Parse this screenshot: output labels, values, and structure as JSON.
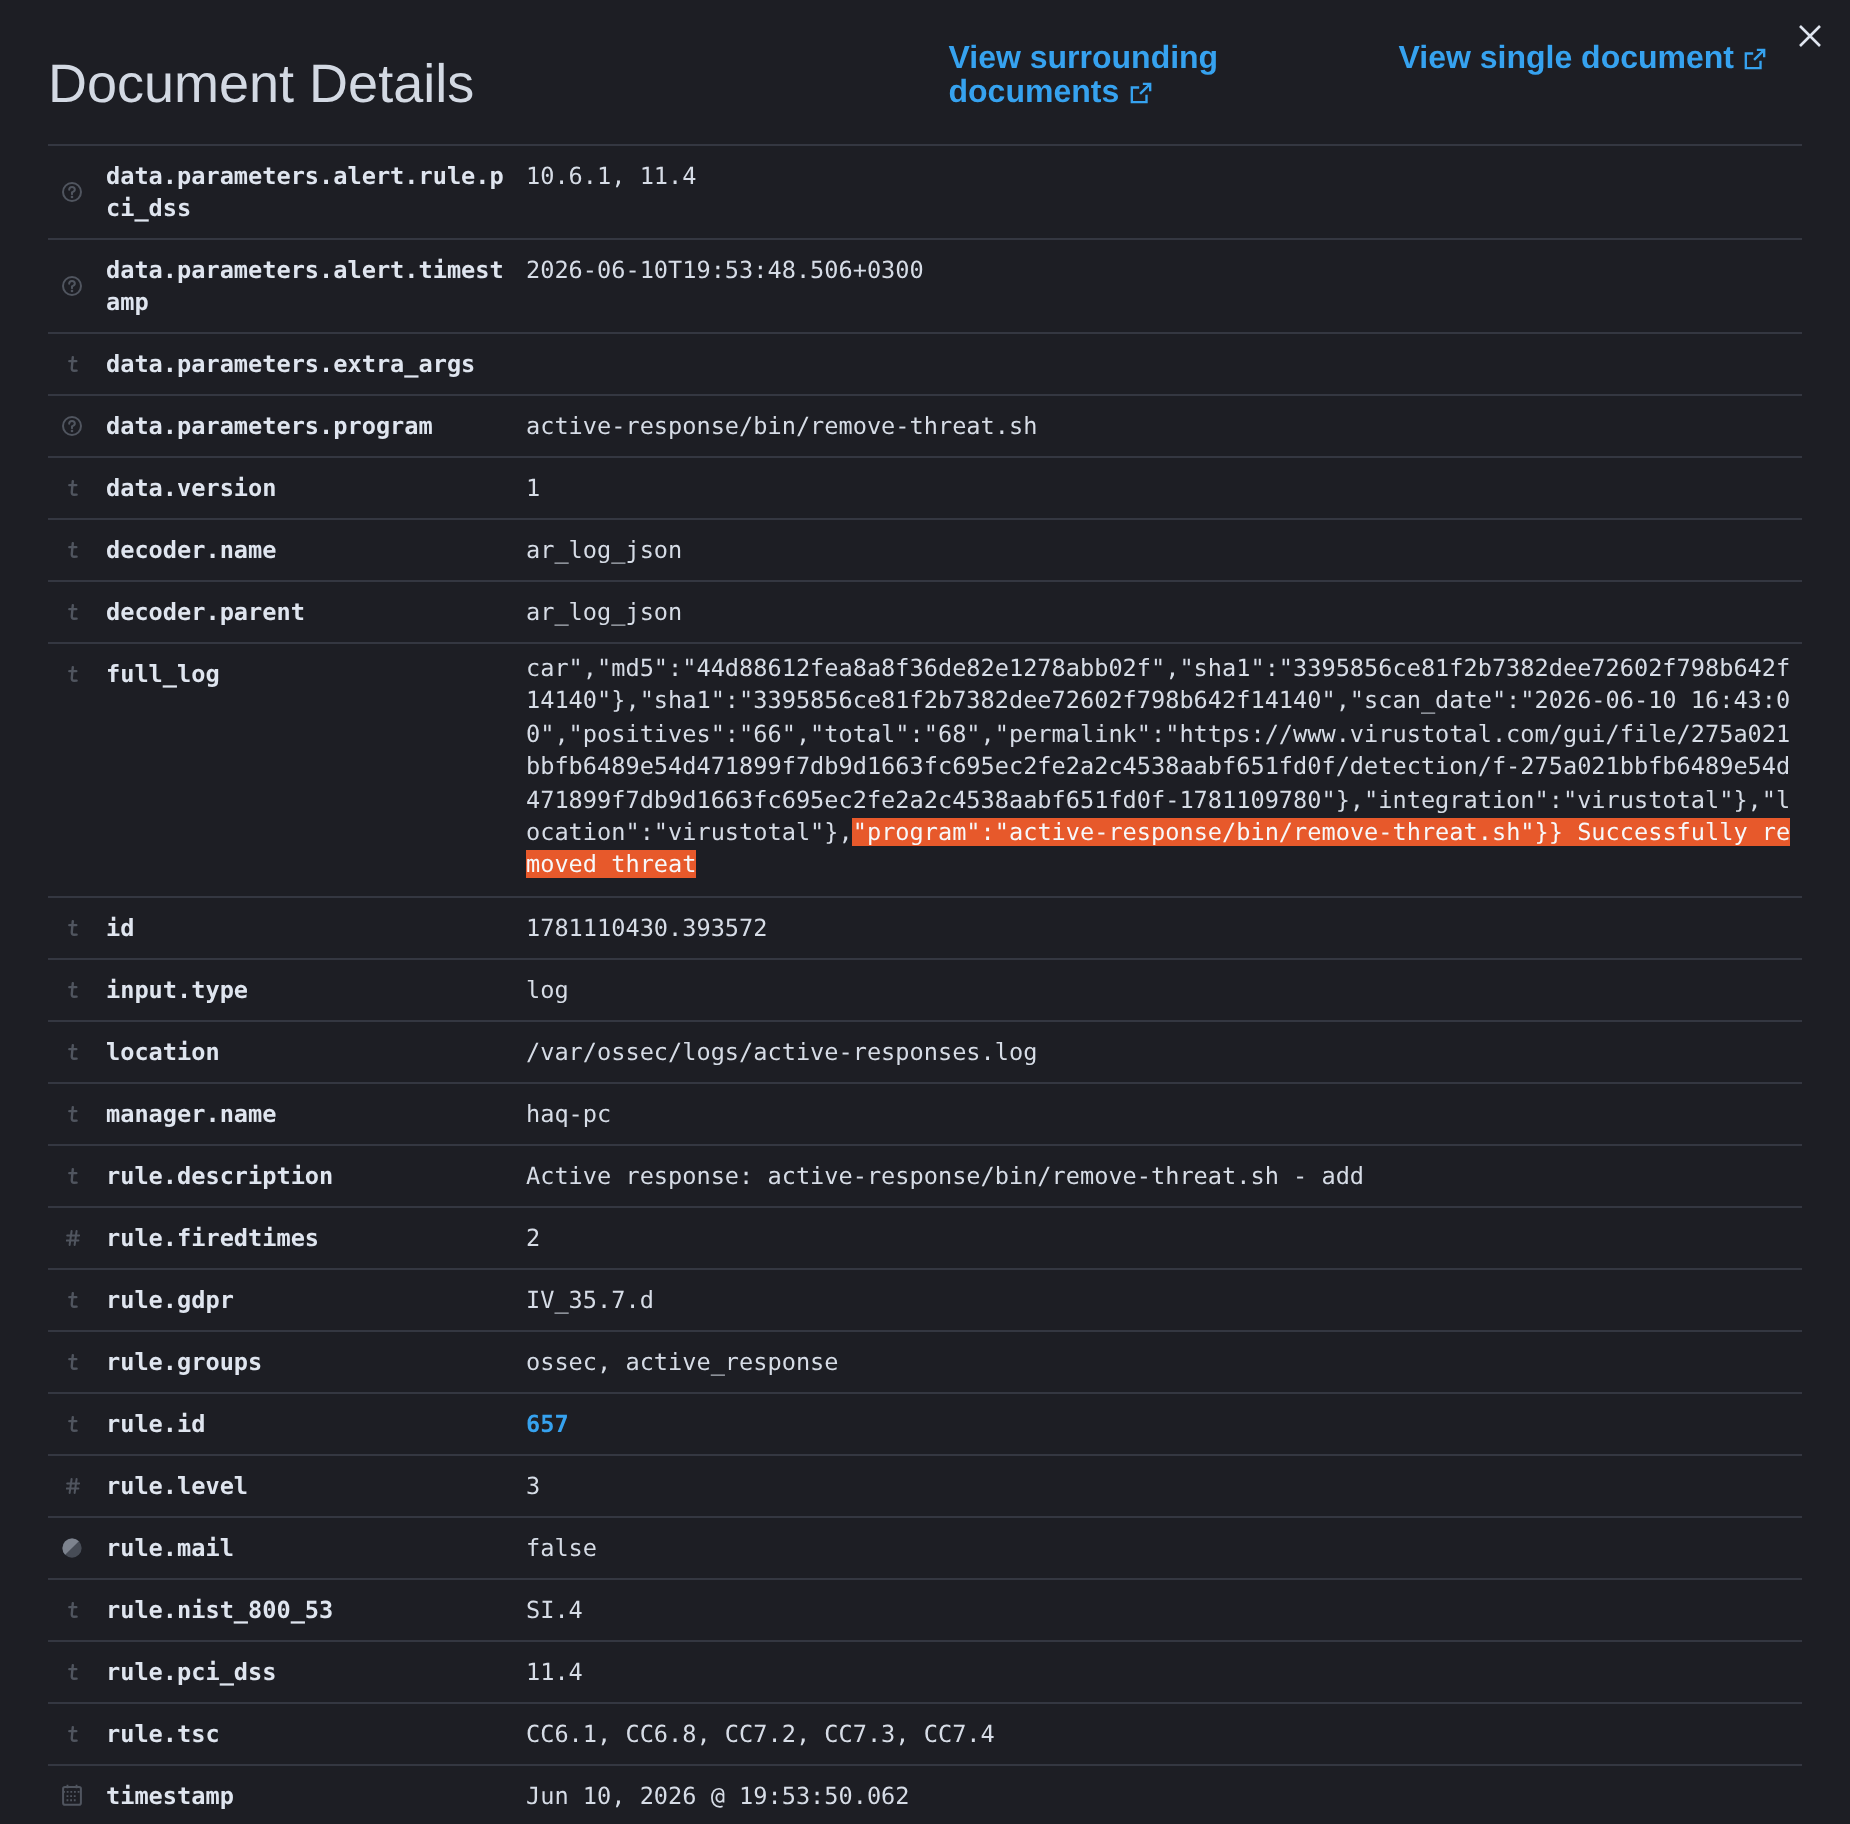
{
  "header": {
    "title": "Document Details",
    "links": [
      {
        "label": "View surrounding documents"
      },
      {
        "label": "View single document"
      }
    ]
  },
  "rows": [
    {
      "field": "data.parameters.alert.rule.pci_dss",
      "kind": "unknown",
      "value": {
        "kind": "text",
        "text": "10.6.1, 11.4"
      }
    },
    {
      "field": "data.parameters.alert.timestamp",
      "kind": "unknown",
      "value": {
        "kind": "text",
        "text": "2026-06-10T19:53:48.506+0300"
      }
    },
    {
      "field": "data.parameters.extra_args",
      "kind": "string"
    },
    {
      "field": "data.parameters.program",
      "kind": "unknown",
      "value": {
        "kind": "text",
        "text": "active-response/bin/remove-threat.sh"
      }
    },
    {
      "field": "data.version",
      "kind": "string",
      "value": {
        "kind": "text",
        "text": "1"
      }
    },
    {
      "field": "decoder.name",
      "kind": "string",
      "value": {
        "kind": "text",
        "text": "ar_log_json"
      }
    },
    {
      "field": "decoder.parent",
      "kind": "string",
      "value": {
        "kind": "text",
        "text": "ar_log_json"
      }
    },
    {
      "field": "full_log",
      "kind": "string",
      "value": {
        "kind": "log",
        "parts": [
          {
            "text": "car\",\"md5\":\"44d88612fea8a8f36de82e1278abb02f\",\"sha1\":\"3395856ce81f2b7382dee72602f798b642f14140\"},\"sha1\":\"3395856ce81f2b7382dee72602f798b642f14140\",\"scan_date\":\"2026-06-10 16:43:00\",\"positives\":\"66\",\"total\":\"68\",\"permalink\":\"https://www.virustotal.com/gui/file/275a021bbfb6489e54d471899f7db9d1663fc695ec2fe2a2c4538aabf651fd0f/detection/f-275a021bbfb6489e54d471899f7db9d1663fc695ec2fe2a2c4538aabf651fd0f-1781109780\"},\"integration\":\"virustotal\"},\"location\":\"virustotal\"},",
            "highlighted": false
          },
          {
            "text": "\"program\":\"active-response/bin/remove-threat.sh\"}} Successfully removed threat",
            "highlighted": true
          }
        ]
      }
    },
    {
      "field": "id",
      "kind": "string",
      "value": {
        "kind": "text",
        "text": "1781110430.393572"
      }
    },
    {
      "field": "input.type",
      "kind": "string",
      "value": {
        "kind": "text",
        "text": "log"
      }
    },
    {
      "field": "location",
      "kind": "string",
      "value": {
        "kind": "text",
        "text": "/var/ossec/logs/active-responses.log"
      }
    },
    {
      "field": "manager.name",
      "kind": "string",
      "value": {
        "kind": "text",
        "text": "haq-pc"
      }
    },
    {
      "field": "rule.description",
      "kind": "string",
      "value": {
        "kind": "text",
        "text": "Active response: active-response/bin/remove-threat.sh - add"
      }
    },
    {
      "field": "rule.firedtimes",
      "kind": "number",
      "value": {
        "kind": "text",
        "text": "2"
      }
    },
    {
      "field": "rule.gdpr",
      "kind": "string",
      "value": {
        "kind": "text",
        "text": "IV_35.7.d"
      }
    },
    {
      "field": "rule.groups",
      "kind": "string",
      "value": {
        "kind": "text",
        "text": "ossec, active_response"
      }
    },
    {
      "field": "rule.id",
      "kind": "string",
      "value": {
        "kind": "link",
        "text": "657"
      }
    },
    {
      "field": "rule.level",
      "kind": "number",
      "value": {
        "kind": "text",
        "text": "3"
      }
    },
    {
      "field": "rule.mail",
      "kind": "boolean",
      "value": {
        "kind": "text",
        "text": "false"
      }
    },
    {
      "field": "rule.nist_800_53",
      "kind": "string",
      "value": {
        "kind": "text",
        "text": "SI.4"
      }
    },
    {
      "field": "rule.pci_dss",
      "kind": "string",
      "value": {
        "kind": "text",
        "text": "11.4"
      }
    },
    {
      "field": "rule.tsc",
      "kind": "string",
      "value": {
        "kind": "text",
        "text": "CC6.1, CC6.8, CC7.2, CC7.3, CC7.4"
      }
    },
    {
      "field": "timestamp",
      "kind": "date",
      "value": {
        "kind": "text",
        "text": "Jun 10, 2026 @ 19:53:50.062"
      }
    }
  ]
}
